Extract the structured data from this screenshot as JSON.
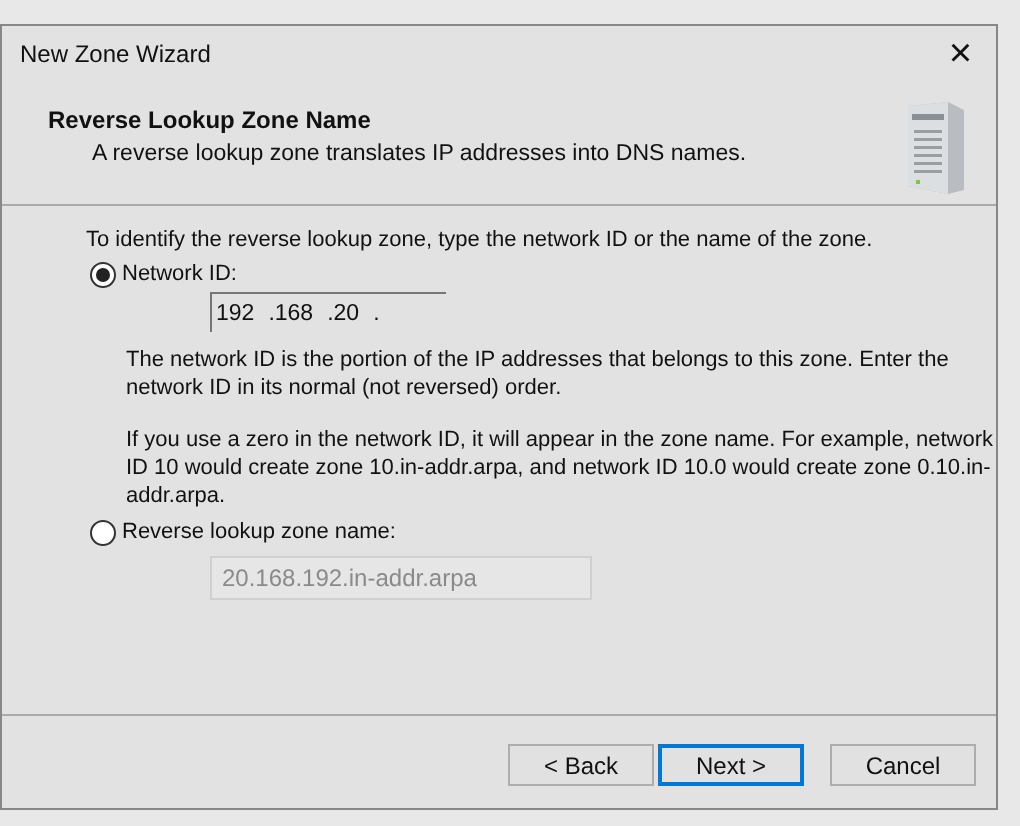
{
  "window": {
    "title": "New Zone Wizard",
    "close": "×"
  },
  "header": {
    "title": "Reverse Lookup Zone Name",
    "subtitle": "A reverse lookup zone translates IP addresses into DNS names."
  },
  "intro": "To identify the reverse lookup zone, type the network ID or the name of the zone.",
  "options": [
    {
      "label": "Network ID:",
      "selected": true,
      "kind": "ip",
      "segments": [
        "192",
        ".168",
        ".20",
        "."
      ],
      "disabled": false,
      "notes": [
        "The network ID is the portion of the IP addresses that belongs to this zone. Enter the network ID in its normal (not reversed) order.",
        "If you use a zero in the network ID, it will appear in the zone name. For example, network ID 10 would create zone 10.in-addr.arpa, and network ID 10.0 would create zone 0.10.in-addr.arpa."
      ]
    },
    {
      "label": "Reverse lookup zone name:",
      "selected": false,
      "kind": "text",
      "value": "20.168.192.in-addr.arpa",
      "disabled": true
    }
  ],
  "buttons": [
    {
      "label": "< Back",
      "default": false
    },
    {
      "label": "Next >",
      "default": true
    },
    {
      "label": "Cancel",
      "default": false
    }
  ]
}
